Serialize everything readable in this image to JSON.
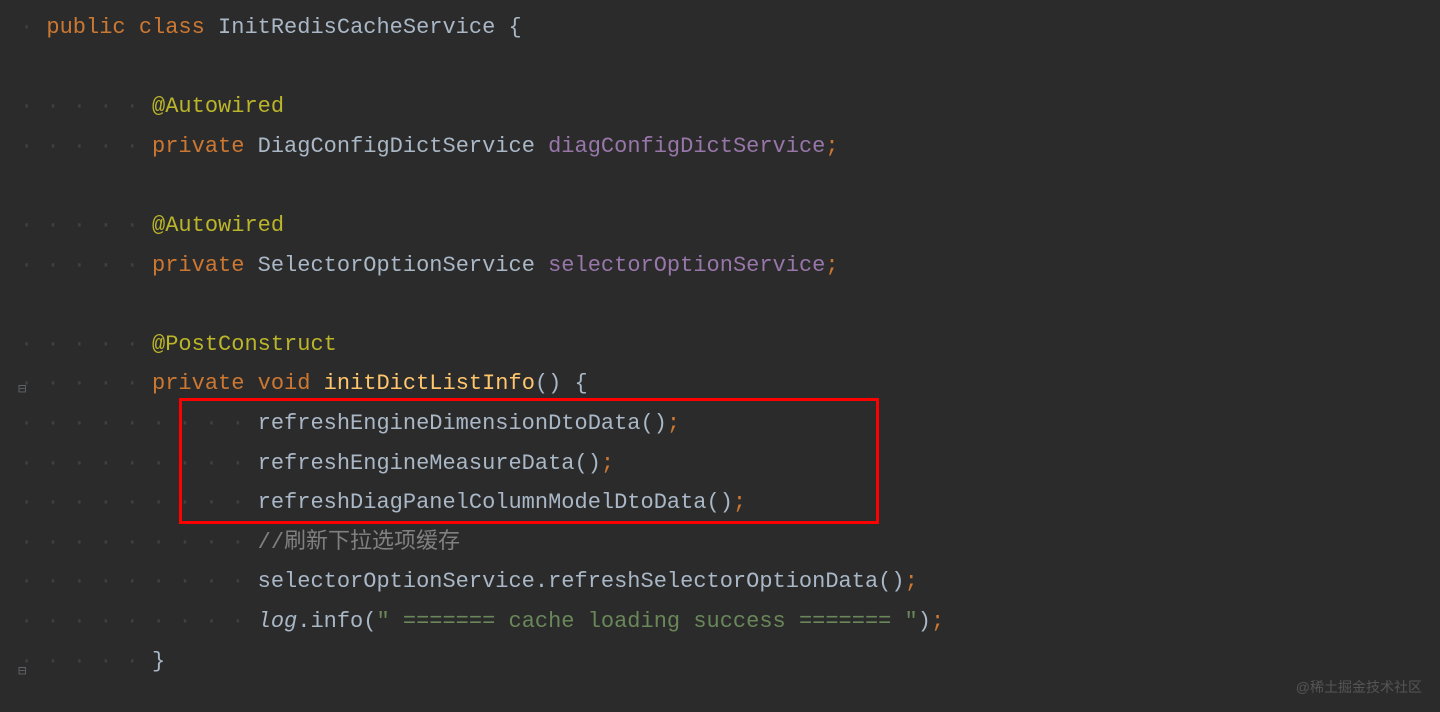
{
  "code": {
    "l1_kw1": "public",
    "l1_kw2": "class",
    "l1_class": "InitRedisCacheService",
    "l1_brace": "{",
    "ann_autowired": "@Autowired",
    "ann_postconstruct": "@PostConstruct",
    "kw_private": "private",
    "kw_void": "void",
    "type1": "DiagConfigDictService",
    "field1": "diagConfigDictService",
    "type2": "SelectorOptionService",
    "field2": "selectorOptionService",
    "method_init": "initDictListInfo",
    "call1": "refreshEngineDimensionDtoData",
    "call2": "refreshEngineMeasureData",
    "call3": "refreshDiagPanelColumnModelDtoData",
    "comment1": "//刷新下拉选项缓存",
    "obj4": "selectorOptionService",
    "call4": "refreshSelectorOptionData",
    "log_obj": "log",
    "log_method": "info",
    "log_str": "\" ======= cache loading success ======= \"",
    "semi": ";",
    "paren_open": "(",
    "paren_close": ")",
    "brace_open": "{",
    "brace_close": "}",
    "dot": "."
  },
  "watermark": "@稀土掘金技术社区",
  "fold_minus": "⊟",
  "fold_end": "⊟"
}
